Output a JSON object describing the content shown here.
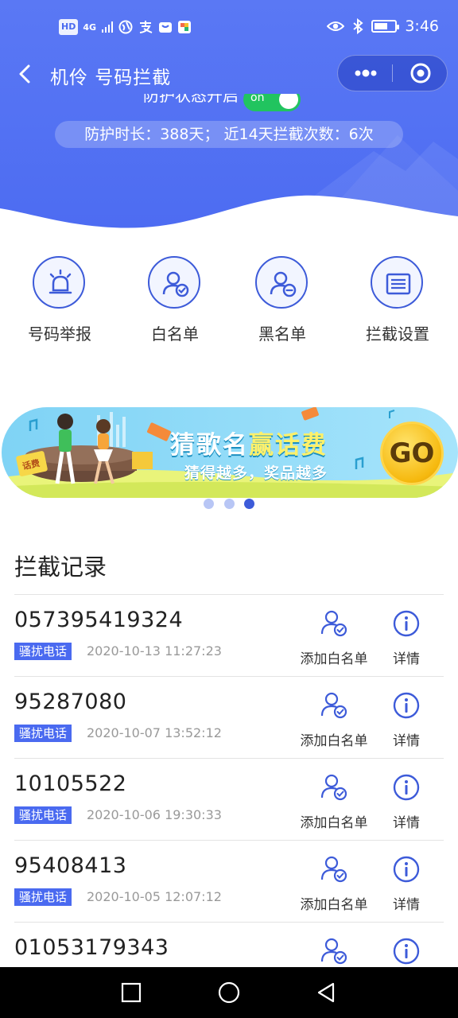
{
  "status_bar": {
    "hd": "HD",
    "network": "4G",
    "time": "3:46"
  },
  "nav": {
    "title": "机伶 号码拦截"
  },
  "protection": {
    "label": "防护状态开启",
    "toggle_text": "on",
    "stats": "防护时长：388天；  近14天拦截次数：6次"
  },
  "actions": [
    {
      "label": "号码举报",
      "icon": "alarm-light-icon"
    },
    {
      "label": "白名单",
      "icon": "user-check-icon"
    },
    {
      "label": "黑名单",
      "icon": "user-minus-icon"
    },
    {
      "label": "拦截设置",
      "icon": "list-settings-icon"
    }
  ],
  "banner": {
    "headline_a": "猜歌名",
    "headline_b": "赢话费",
    "subline": "猜得越多，奖品越多",
    "go": "GO",
    "ticket": "话费",
    "active_dot": 3,
    "dot_count": 3
  },
  "records": {
    "title": "拦截记录",
    "add_label": "添加白名单",
    "detail_label": "详情",
    "items": [
      {
        "number": "057395419324",
        "tag": "骚扰电话",
        "time": "2020-10-13 11:27:23"
      },
      {
        "number": "95287080",
        "tag": "骚扰电话",
        "time": "2020-10-07 13:52:12"
      },
      {
        "number": "10105522",
        "tag": "骚扰电话",
        "time": "2020-10-06 19:30:33"
      },
      {
        "number": "95408413",
        "tag": "骚扰电话",
        "time": "2020-10-05 12:07:12"
      },
      {
        "number": "01053179343",
        "tag": "",
        "time": ""
      }
    ]
  },
  "colors": {
    "primary": "#4a6af0",
    "toggle_on": "#21c45f"
  }
}
